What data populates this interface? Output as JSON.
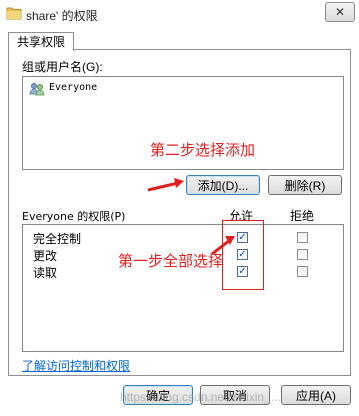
{
  "window": {
    "title": "share' 的权限",
    "close_label": "✕"
  },
  "tabs": [
    {
      "label": "共享权限"
    }
  ],
  "groups_label": "组或用户名(G):",
  "users": [
    {
      "name": "Everyone"
    }
  ],
  "buttons": {
    "add": "添加(D)...",
    "remove": "删除(R)",
    "ok": "确定",
    "cancel": "取消",
    "apply": "应用(A)"
  },
  "permissions": {
    "header": "Everyone 的权限(P)",
    "allow_label": "允许",
    "deny_label": "拒绝",
    "rows": [
      {
        "name": "完全控制",
        "allow": true,
        "deny": false
      },
      {
        "name": "更改",
        "allow": true,
        "deny": false
      },
      {
        "name": "读取",
        "allow": true,
        "deny": false
      }
    ]
  },
  "link_text": "了解访问控制和权限",
  "annotations": {
    "step2": "第二步选择添加",
    "step1": "第一步全部选择"
  },
  "watermark": "https://blog.csdn.net/weixin_..."
}
